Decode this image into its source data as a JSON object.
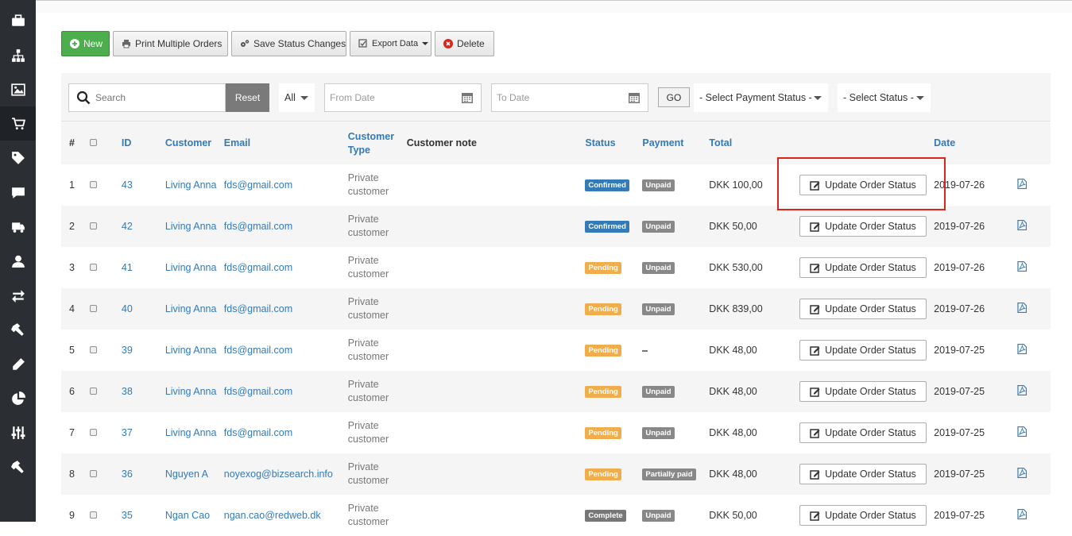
{
  "sidebar": {
    "items": [
      {
        "icon": "briefcase-icon"
      },
      {
        "icon": "sitemap-icon"
      },
      {
        "icon": "image-icon"
      },
      {
        "icon": "cart-icon",
        "active": true
      },
      {
        "icon": "tag-icon"
      },
      {
        "icon": "comment-icon"
      },
      {
        "icon": "truck-icon"
      },
      {
        "icon": "user-icon"
      },
      {
        "icon": "exchange-icon"
      },
      {
        "icon": "hammer-icon"
      },
      {
        "icon": "pencil-icon"
      },
      {
        "icon": "pie-chart-icon"
      },
      {
        "icon": "sliders-icon"
      },
      {
        "icon": "gavel-icon"
      }
    ]
  },
  "toolbar": {
    "new_label": "New",
    "print_label": "Print Multiple Orders",
    "save_status_label": "Save Status Changes",
    "export_label": "Export Data",
    "delete_label": "Delete"
  },
  "filters": {
    "search_placeholder": "Search",
    "reset_label": "Reset",
    "all_label": "All",
    "from_date_placeholder": "From Date",
    "to_date_placeholder": "To Date",
    "go_label": "GO",
    "payment_status_label": "- Select Payment Status -",
    "status_label": "- Select Status -"
  },
  "table": {
    "headers": {
      "num": "#",
      "id": "ID",
      "customer": "Customer",
      "email": "Email",
      "customer_type": "Customer Type",
      "customer_note": "Customer note",
      "status": "Status",
      "payment": "Payment",
      "total": "Total",
      "date": "Date"
    },
    "update_label": "Update Order Status",
    "rows": [
      {
        "num": "1",
        "id": "43",
        "customer": "Living Anna",
        "email": "fds@gmail.com",
        "type": "Private customer",
        "status": "Confirmed",
        "payment": "Unpaid",
        "total": "DKK 100,00",
        "date": "2019-07-26"
      },
      {
        "num": "2",
        "id": "42",
        "customer": "Living Anna",
        "email": "fds@gmail.com",
        "type": "Private customer",
        "status": "Confirmed",
        "payment": "Unpaid",
        "total": "DKK 50,00",
        "date": "2019-07-26"
      },
      {
        "num": "3",
        "id": "41",
        "customer": "Living Anna",
        "email": "fds@gmail.com",
        "type": "Private customer",
        "status": "Pending",
        "payment": "Unpaid",
        "total": "DKK 530,00",
        "date": "2019-07-26"
      },
      {
        "num": "4",
        "id": "40",
        "customer": "Living Anna",
        "email": "fds@gmail.com",
        "type": "Private customer",
        "status": "Pending",
        "payment": "Unpaid",
        "total": "DKK 839,00",
        "date": "2019-07-26"
      },
      {
        "num": "5",
        "id": "39",
        "customer": "Living Anna",
        "email": "fds@gmail.com",
        "type": "Private customer",
        "status": "Pending",
        "payment": "",
        "total": "DKK 48,00",
        "date": "2019-07-25"
      },
      {
        "num": "6",
        "id": "38",
        "customer": "Living Anna",
        "email": "fds@gmail.com",
        "type": "Private customer",
        "status": "Pending",
        "payment": "Unpaid",
        "total": "DKK 48,00",
        "date": "2019-07-25"
      },
      {
        "num": "7",
        "id": "37",
        "customer": "Living Anna",
        "email": "fds@gmail.com",
        "type": "Private customer",
        "status": "Pending",
        "payment": "Unpaid",
        "total": "DKK 48,00",
        "date": "2019-07-25"
      },
      {
        "num": "8",
        "id": "36",
        "customer": "Nguyen A",
        "email": "noyexog@bizsearch.info",
        "type": "Private customer",
        "status": "Pending",
        "payment": "Partially paid",
        "total": "DKK 48,00",
        "date": "2019-07-25"
      },
      {
        "num": "9",
        "id": "35",
        "customer": "Ngan Cao",
        "email": "ngan.cao@redweb.dk",
        "type": "Private customer",
        "status": "Complete",
        "payment": "Unpaid",
        "total": "DKK 50,00",
        "date": "2019-07-25"
      }
    ]
  },
  "colors": {
    "sidebar_bg": "#2b2f33",
    "new_button": "#4cae4c",
    "link": "#337ab7",
    "confirmed": "#337ab7",
    "pending": "#f0ad4e",
    "complete": "#777777",
    "highlight": "#d9261c"
  }
}
